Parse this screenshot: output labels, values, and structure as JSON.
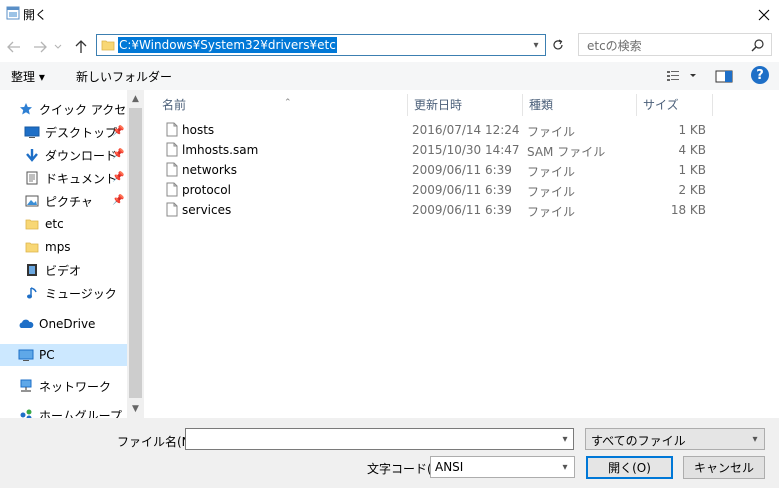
{
  "window": {
    "title": "開く"
  },
  "address": {
    "path": "C:¥Windows¥System32¥drivers¥etc"
  },
  "search": {
    "placeholder": "etcの検索"
  },
  "toolbar": {
    "organize_label": "整理 ▾",
    "new_folder_label": "新しいフォルダー"
  },
  "sidebar": {
    "items": [
      {
        "label": "クイック アクセス",
        "icon": "star-icon",
        "pinned": false
      },
      {
        "label": "デスクトップ",
        "icon": "desktop-icon",
        "pinned": true
      },
      {
        "label": "ダウンロード",
        "icon": "download-icon",
        "pinned": true
      },
      {
        "label": "ドキュメント",
        "icon": "document-icon",
        "pinned": true
      },
      {
        "label": "ピクチャ",
        "icon": "picture-icon",
        "pinned": true
      },
      {
        "label": "etc",
        "icon": "folder-icon",
        "pinned": false
      },
      {
        "label": "mps",
        "icon": "folder-icon",
        "pinned": false
      },
      {
        "label": "ビデオ",
        "icon": "video-icon",
        "pinned": false
      },
      {
        "label": "ミュージック",
        "icon": "music-icon",
        "pinned": false
      },
      {
        "label": "OneDrive",
        "icon": "cloud-icon",
        "pinned": false
      },
      {
        "label": "PC",
        "icon": "pc-icon",
        "pinned": false,
        "selected": true
      },
      {
        "label": "ネットワーク",
        "icon": "network-icon",
        "pinned": false
      },
      {
        "label": "ホームグループ",
        "icon": "homegroup-icon",
        "pinned": false
      }
    ]
  },
  "columns": {
    "name": "名前",
    "date": "更新日時",
    "type": "種類",
    "size": "サイズ"
  },
  "files": [
    {
      "name": "hosts",
      "date": "2016/07/14 12:24",
      "type": "ファイル",
      "size": "1 KB"
    },
    {
      "name": "lmhosts.sam",
      "date": "2015/10/30 14:47",
      "type": "SAM ファイル",
      "size": "4 KB"
    },
    {
      "name": "networks",
      "date": "2009/06/11 6:39",
      "type": "ファイル",
      "size": "1 KB"
    },
    {
      "name": "protocol",
      "date": "2009/06/11 6:39",
      "type": "ファイル",
      "size": "2 KB"
    },
    {
      "name": "services",
      "date": "2009/06/11 6:39",
      "type": "ファイル",
      "size": "18 KB"
    }
  ],
  "bottom": {
    "filename_label": "ファイル名(N):",
    "filename_value": "",
    "filter_value": "すべてのファイル",
    "encoding_label": "文字コード(E):",
    "encoding_value": "ANSI",
    "open_label": "開く(O)",
    "cancel_label": "キャンセル"
  },
  "colors": {
    "accent": "#0078d7",
    "selected_bg": "#cce8ff",
    "help": "#1e6fc7"
  }
}
